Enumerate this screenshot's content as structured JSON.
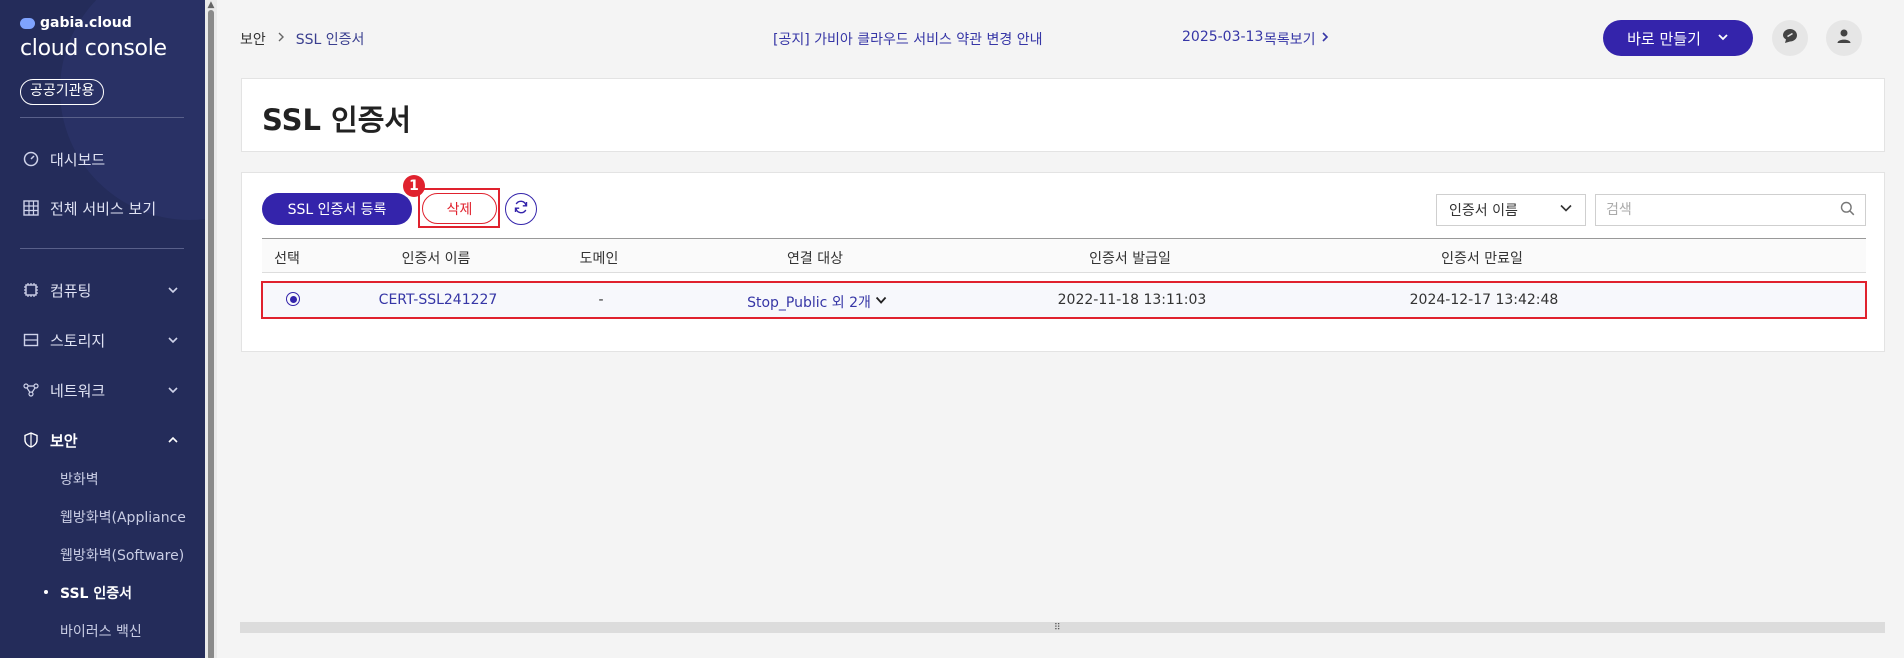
{
  "sidebar": {
    "logo_small": "gabia.cloud",
    "logo_big_a": "cloud",
    "logo_big_b": " console",
    "badge": "공공기관용",
    "items": [
      {
        "label": "대시보드",
        "icon": "dashboard-icon"
      },
      {
        "label": "전체 서비스 보기",
        "icon": "grid-icon"
      },
      {
        "label": "컴퓨팅",
        "icon": "cpu-icon"
      },
      {
        "label": "스토리지",
        "icon": "storage-icon"
      },
      {
        "label": "네트워크",
        "icon": "network-icon"
      },
      {
        "label": "보안",
        "icon": "shield-icon"
      }
    ],
    "security_sub": [
      "방화벽",
      "웹방화벽(Appliance",
      "웹방화벽(Software)",
      "SSL 인증서",
      "바이러스 백신"
    ]
  },
  "topbar": {
    "breadcrumb": [
      "보안",
      "SSL 인증서"
    ],
    "notice": "[공지] 가비아 클라우드 서비스 약관 변경 안내",
    "notice_date": "2025-03-13",
    "notice_list": "목록보기",
    "quick_create": "바로 만들기"
  },
  "page": {
    "title": "SSL 인증서"
  },
  "toolbar": {
    "register": "SSL 인증서 등록",
    "delete": "삭제",
    "step": "1",
    "filter_selected": "인증서 이름",
    "search_placeholder": "검색"
  },
  "table": {
    "headers": [
      "선택",
      "인증서 이름",
      "도메인",
      "연결 대상",
      "인증서 발급일",
      "인증서 만료일"
    ],
    "rows": [
      {
        "name": "CERT-SSL241227",
        "domain": "-",
        "target": "Stop_Public 외 2개",
        "issued": "2022-11-18 13:11:03",
        "expires": "2024-12-17 13:42:48",
        "selected": true
      }
    ]
  },
  "colors": {
    "sidebar_bg": "#242c5a",
    "accent": "#3424ab",
    "highlight": "#e0222e"
  }
}
